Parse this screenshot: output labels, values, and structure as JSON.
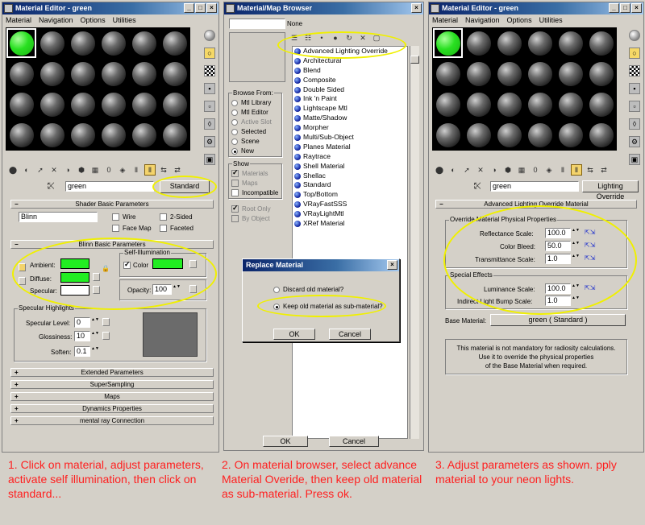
{
  "left": {
    "title": "Material Editor - green",
    "menu": [
      "Material",
      "Navigation",
      "Options",
      "Utilities"
    ],
    "material_name": "green",
    "type_button": "Standard",
    "shader_rollout": "Shader Basic Parameters",
    "shader": "Blinn",
    "wire": "Wire",
    "two_sided": "2-Sided",
    "face_map": "Face Map",
    "faceted": "Faceted",
    "blinn_rollout": "Blinn Basic Parameters",
    "self_illum_group": "Self-Illumination",
    "ambient": "Ambient:",
    "diffuse": "Diffuse:",
    "specular": "Specular:",
    "color_label": "Color",
    "opacity_label": "Opacity:",
    "opacity_value": "100",
    "spec_group": "Specular Highlights",
    "spec_level_label": "Specular Level:",
    "spec_level_value": "0",
    "gloss_label": "Glossiness:",
    "gloss_value": "10",
    "soften_label": "Soften:",
    "soften_value": "0.1",
    "rollouts": [
      "Extended Parameters",
      "SuperSampling",
      "Maps",
      "Dynamics Properties",
      "mental ray Connection"
    ],
    "colors": {
      "ambient": "#22ee22",
      "diffuse": "#22ee22",
      "specular": "#ffffff",
      "self_illum": "#22ee22"
    }
  },
  "browser": {
    "title": "Material/Map Browser",
    "selected_display": "None",
    "browse_from_label": "Browse From:",
    "browse_from": [
      "Mtl Library",
      "Mtl Editor",
      "Active Slot",
      "Selected",
      "Scene",
      "New"
    ],
    "show_label": "Show",
    "show": [
      "Materials",
      "Maps",
      "Incompatible"
    ],
    "extra": [
      "Root Only",
      "By Object"
    ],
    "materials": [
      "Advanced Lighting Override",
      "Architectural",
      "Blend",
      "Composite",
      "Double Sided",
      "Ink 'n Paint",
      "Lightscape Mtl",
      "Matte/Shadow",
      "Morpher",
      "Multi/Sub-Object",
      "Planes Material",
      "Raytrace",
      "Shell Material",
      "Shellac",
      "Standard",
      "Top/Bottom",
      "VRayFastSSS",
      "VRayLightMtl",
      "XRef Material"
    ],
    "ok": "OK",
    "cancel": "Cancel"
  },
  "replace_dialog": {
    "title": "Replace Material",
    "option1": "Discard old material?",
    "option2": "Keep old material as sub-material?",
    "ok": "OK",
    "cancel": "Cancel"
  },
  "right": {
    "title": "Material Editor - green",
    "menu": [
      "Material",
      "Navigation",
      "Options",
      "Utilities"
    ],
    "material_name": "green",
    "type_button": "Lighting Override",
    "rollout": "Advanced Lighting Override Material",
    "physical_group": "Override Material Physical Properties",
    "reflectance_label": "Reflectance Scale:",
    "reflectance_value": "100.0",
    "bleed_label": "Color Bleed:",
    "bleed_value": "50.0",
    "transmittance_label": "Transmittance Scale:",
    "transmittance_value": "1.0",
    "special_group": "Special Effects",
    "luminance_label": "Luminance Scale:",
    "luminance_value": "100.0",
    "bump_label": "Indirect Light Bump Scale:",
    "bump_value": "1.0",
    "base_label": "Base Material:",
    "base_value": "green  ( Standard )",
    "info_line1": "This material is not mandatory for radiosity calculations.",
    "info_line2": "Use it to override the physical properties",
    "info_line3": "of the Base Material when required."
  },
  "captions": {
    "c1": "1. Click on material, adjust parameters, activate self illumination, then click on standard...",
    "c2": "2. On material browser, select advance Material Overide, then keep old material as sub-material. Press ok.",
    "c3": "3. Adjust parameters as shown. pply material to your neon lights."
  },
  "accent": {
    "annotation": "#f0f000",
    "caption": "#ff1f1f",
    "title_bar": "#0a246a"
  }
}
